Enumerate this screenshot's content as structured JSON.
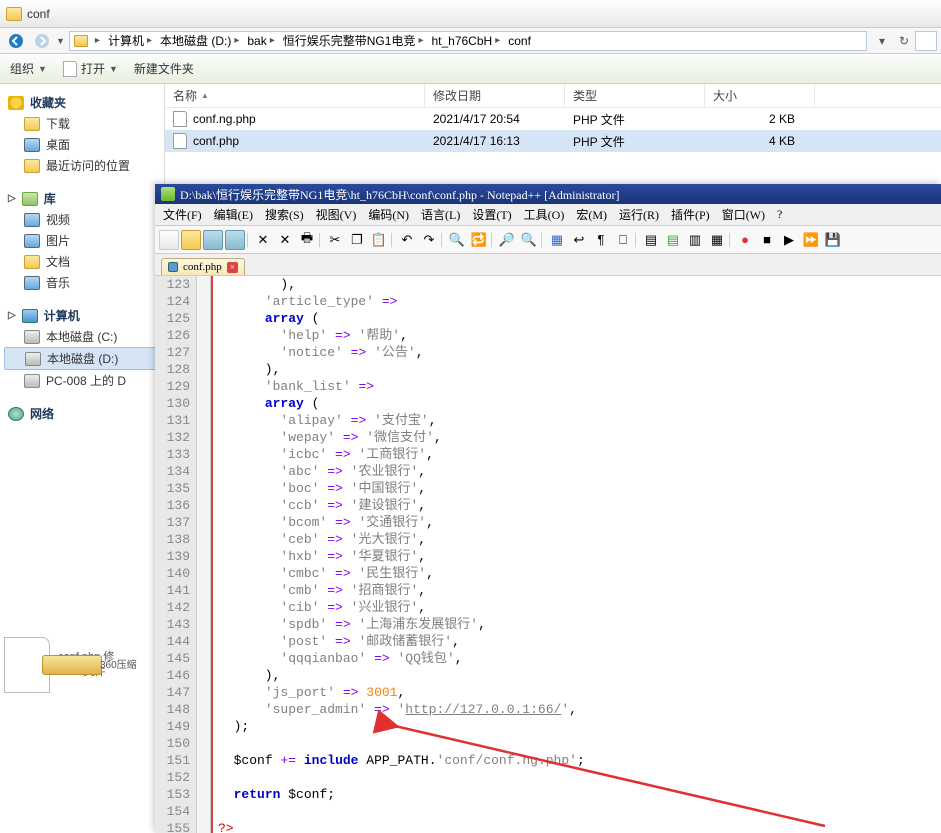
{
  "explorer": {
    "title": "conf",
    "path": [
      "计算机",
      "本地磁盘 (D:)",
      "bak",
      "恒行娱乐完整带NG1电竞",
      "ht_h76CbH",
      "conf"
    ],
    "toolbar": {
      "organize": "组织",
      "open": "打开",
      "newfolder": "新建文件夹"
    },
    "columns": {
      "name": "名称",
      "date": "修改日期",
      "type": "类型",
      "size": "大小"
    },
    "files": [
      {
        "name": "conf.ng.php",
        "date": "2021/4/17 20:54",
        "type": "PHP 文件",
        "size": "2 KB",
        "sel": false
      },
      {
        "name": "conf.php",
        "date": "2021/4/17 16:13",
        "type": "PHP 文件",
        "size": "4 KB",
        "sel": true
      }
    ],
    "sidebar": {
      "fav": {
        "title": "收藏夹",
        "items": [
          "下载",
          "桌面",
          "最近访问的位置"
        ]
      },
      "lib": {
        "title": "库",
        "items": [
          "视频",
          "图片",
          "文档",
          "音乐"
        ]
      },
      "pc": {
        "title": "计算机",
        "items": [
          "本地磁盘 (C:)",
          "本地磁盘 (D:)",
          "PC-008 上的 D"
        ]
      },
      "net": {
        "title": "网络"
      }
    },
    "preview": {
      "name": "conf.php 修",
      "type": "PHP 文件"
    },
    "task": "360压缩"
  },
  "npp": {
    "title": "D:\\bak\\恒行娱乐完整带NG1电竞\\ht_h76CbH\\conf\\conf.php - Notepad++ [Administrator]",
    "menus": [
      "文件(F)",
      "编辑(E)",
      "搜索(S)",
      "视图(V)",
      "编码(N)",
      "语言(L)",
      "设置(T)",
      "工具(O)",
      "宏(M)",
      "运行(R)",
      "插件(P)",
      "窗口(W)",
      "?"
    ],
    "tab": "conf.php",
    "lines": [
      {
        "n": 123,
        "t": "        ),",
        "cls": [
          "var"
        ]
      },
      {
        "n": 124,
        "t": "      'article_type' =>",
        "k": "article_type"
      },
      {
        "n": 125,
        "t": "      array (",
        "arr": true
      },
      {
        "n": 126,
        "t": "        'help' => '帮助',",
        "k": "help",
        "v": "帮助"
      },
      {
        "n": 127,
        "t": "        'notice' => '公告',",
        "k": "notice",
        "v": "公告"
      },
      {
        "n": 128,
        "t": "      ),",
        "cls": [
          "var"
        ]
      },
      {
        "n": 129,
        "t": "      'bank_list' =>",
        "k": "bank_list"
      },
      {
        "n": 130,
        "t": "      array (",
        "arr": true
      },
      {
        "n": 131,
        "t": "        'alipay' => '支付宝',",
        "k": "alipay",
        "v": "支付宝"
      },
      {
        "n": 132,
        "t": "        'wepay' => '微信支付',",
        "k": "wepay",
        "v": "微信支付"
      },
      {
        "n": 133,
        "t": "        'icbc' => '工商银行',",
        "k": "icbc",
        "v": "工商银行"
      },
      {
        "n": 134,
        "t": "        'abc' => '农业银行',",
        "k": "abc",
        "v": "农业银行"
      },
      {
        "n": 135,
        "t": "        'boc' => '中国银行',",
        "k": "boc",
        "v": "中国银行"
      },
      {
        "n": 136,
        "t": "        'ccb' => '建设银行',",
        "k": "ccb",
        "v": "建设银行"
      },
      {
        "n": 137,
        "t": "        'bcom' => '交通银行',",
        "k": "bcom",
        "v": "交通银行"
      },
      {
        "n": 138,
        "t": "        'ceb' => '光大银行',",
        "k": "ceb",
        "v": "光大银行"
      },
      {
        "n": 139,
        "t": "        'hxb' => '华夏银行',",
        "k": "hxb",
        "v": "华夏银行"
      },
      {
        "n": 140,
        "t": "        'cmbc' => '民生银行',",
        "k": "cmbc",
        "v": "民生银行"
      },
      {
        "n": 141,
        "t": "        'cmb' => '招商银行',",
        "k": "cmb",
        "v": "招商银行"
      },
      {
        "n": 142,
        "t": "        'cib' => '兴业银行',",
        "k": "cib",
        "v": "兴业银行"
      },
      {
        "n": 143,
        "t": "        'spdb' => '上海浦东发展银行',",
        "k": "spdb",
        "v": "上海浦东发展银行"
      },
      {
        "n": 144,
        "t": "        'post' => '邮政储蓄银行',",
        "k": "post",
        "v": "邮政储蓄银行"
      },
      {
        "n": 145,
        "t": "        'qqqianbao' => 'QQ钱包',",
        "k": "qqqianbao",
        "v": "QQ钱包"
      },
      {
        "n": 146,
        "t": "      ),",
        "cls": [
          "var"
        ]
      },
      {
        "n": 147,
        "t": "      'js_port' => 3001,",
        "k": "js_port",
        "num": "3001"
      },
      {
        "n": 148,
        "t": "      'super_admin' => 'http://127.0.0.1:66/',",
        "k": "super_admin",
        "lnk": "http://127.0.0.1:66/"
      },
      {
        "n": 149,
        "t": "  );",
        "cls": [
          "var"
        ]
      },
      {
        "n": 150,
        "t": "",
        "cls": []
      },
      {
        "n": 151,
        "t": "  $conf += include APP_PATH.'conf/conf.ng.php';",
        "inc": true
      },
      {
        "n": 152,
        "t": "",
        "cls": []
      },
      {
        "n": 153,
        "t": "  return $conf;",
        "ret": true
      },
      {
        "n": 154,
        "t": "",
        "cls": []
      },
      {
        "n": 155,
        "t": "?>",
        "php": true
      }
    ]
  }
}
